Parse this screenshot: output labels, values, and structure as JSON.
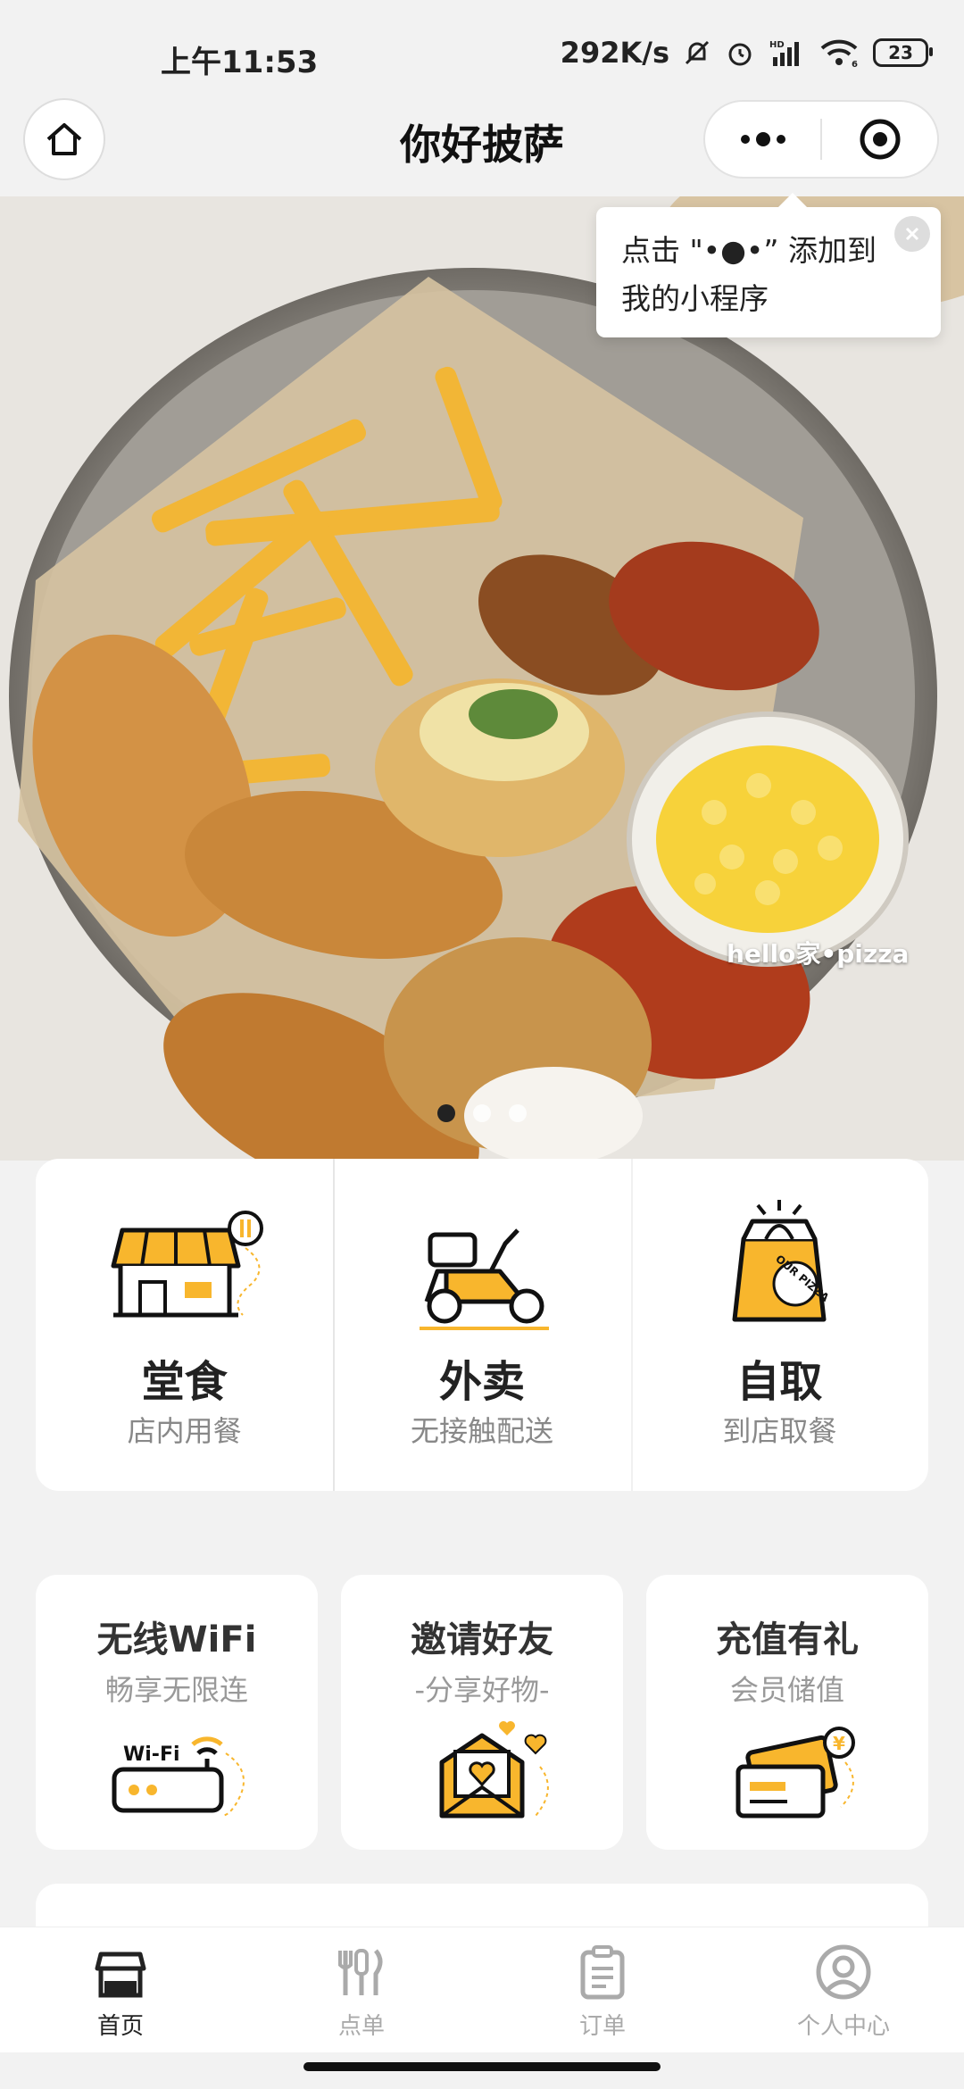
{
  "status_bar": {
    "time": "上午11:53",
    "network_speed": "292K/s",
    "network_type": "HD",
    "wifi_level": "6",
    "battery": "23"
  },
  "nav": {
    "title": "你好披萨"
  },
  "tooltip": {
    "text": "点击 \"•●•” 添加到我的小程序"
  },
  "banner": {
    "watermark": "hello家•pizza",
    "dots": 3,
    "active_dot": 0
  },
  "services": [
    {
      "title": "堂食",
      "subtitle": "店内用餐",
      "icon": "storefront-icon"
    },
    {
      "title": "外卖",
      "subtitle": "无接触配送",
      "icon": "scooter-icon"
    },
    {
      "title": "自取",
      "subtitle": "到店取餐",
      "icon": "pizza-bag-icon",
      "bag_text": "OUR PIZZA"
    }
  ],
  "features": [
    {
      "title": "无线WiFi",
      "subtitle": "畅享无限连",
      "icon": "wifi-router-icon",
      "router_text": "Wi-Fi"
    },
    {
      "title": "邀请好友",
      "subtitle": "-分享好物-",
      "icon": "heart-envelope-icon"
    },
    {
      "title": "充值有礼",
      "subtitle": "会员储值",
      "icon": "card-wallet-icon",
      "coin_text": "¥"
    }
  ],
  "tabs": [
    {
      "label": "首页",
      "icon": "home-store-icon",
      "active": true
    },
    {
      "label": "点单",
      "icon": "utensils-icon",
      "active": false
    },
    {
      "label": "订单",
      "icon": "clipboard-icon",
      "active": false
    },
    {
      "label": "个人中心",
      "icon": "user-icon",
      "active": false
    }
  ],
  "colors": {
    "accent": "#f8b62d",
    "background": "#f2f2f2",
    "text": "#222222",
    "muted": "#888888"
  }
}
